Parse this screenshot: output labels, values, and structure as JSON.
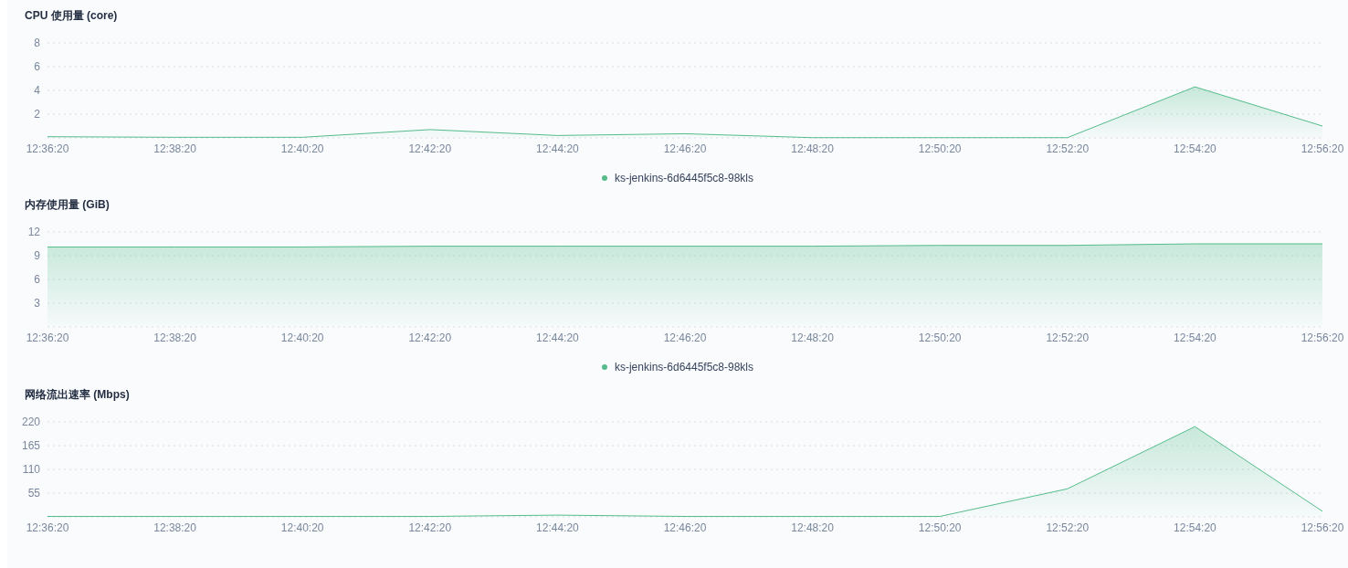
{
  "charts": [
    {
      "chart_data": {
        "type": "area",
        "grid": true,
        "title": "CPU 使用量 (core)",
        "categories": [
          "12:36:20",
          "12:38:20",
          "12:40:20",
          "12:42:20",
          "12:44:20",
          "12:46:20",
          "12:48:20",
          "12:50:20",
          "12:52:20",
          "12:54:20",
          "12:56:20"
        ],
        "ylim": [
          0,
          8
        ],
        "yticks": [
          2,
          4,
          6,
          8
        ],
        "series": [
          {
            "name": "ks-jenkins-6d6445f5c8-98kls",
            "color": "#55bc8a",
            "values": [
              0.1,
              0.05,
              0.05,
              0.7,
              0.2,
              0.35,
              0.02,
              0.02,
              0.02,
              4.3,
              1.0
            ]
          }
        ]
      }
    },
    {
      "chart_data": {
        "type": "area",
        "grid": true,
        "title": "内存使用量 (GiB)",
        "categories": [
          "12:36:20",
          "12:38:20",
          "12:40:20",
          "12:42:20",
          "12:44:20",
          "12:46:20",
          "12:48:20",
          "12:50:20",
          "12:52:20",
          "12:54:20",
          "12:56:20"
        ],
        "ylim": [
          0,
          12
        ],
        "yticks": [
          3,
          6,
          9,
          12
        ],
        "series": [
          {
            "name": "ks-jenkins-6d6445f5c8-98kls",
            "color": "#55bc8a",
            "values": [
              10.1,
              10.1,
              10.1,
              10.2,
              10.2,
              10.2,
              10.2,
              10.3,
              10.3,
              10.5,
              10.5
            ]
          }
        ]
      }
    },
    {
      "chart_data": {
        "type": "area",
        "grid": true,
        "title": "网络流出速率 (Mbps)",
        "categories": [
          "12:36:20",
          "12:38:20",
          "12:40:20",
          "12:42:20",
          "12:44:20",
          "12:46:20",
          "12:48:20",
          "12:50:20",
          "12:52:20",
          "12:54:20",
          "12:56:20"
        ],
        "ylim": [
          0,
          220
        ],
        "yticks": [
          55,
          110,
          165,
          220
        ],
        "series": [
          {
            "color": "#55bc8a",
            "values": [
              1,
              1,
              1,
              1,
              4,
              1,
              1,
              1,
              65,
              209,
              13
            ]
          }
        ]
      }
    }
  ]
}
